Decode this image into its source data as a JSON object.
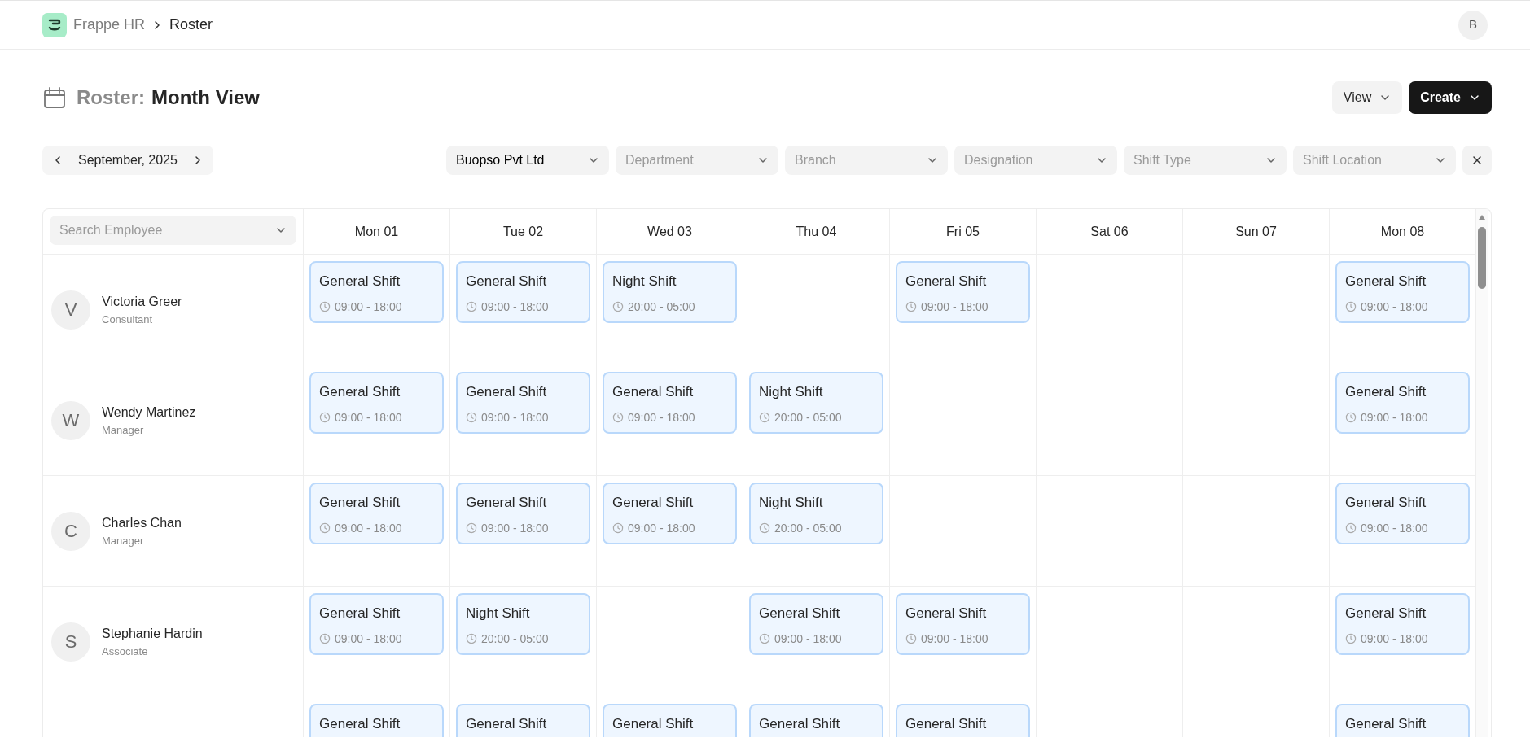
{
  "breadcrumbs": [
    {
      "label": "Frappe HR",
      "current": false
    },
    {
      "label": "Roster",
      "current": true
    }
  ],
  "user_avatar": {
    "initial": "B"
  },
  "page_header": {
    "title_prefix": "Roster:",
    "title": "Month View",
    "buttons": [
      {
        "label": "View",
        "kind": "secondary"
      },
      {
        "label": "Create",
        "kind": "primary"
      }
    ]
  },
  "month_nav": {
    "label": "September, 2025"
  },
  "filters": [
    {
      "value": "Buopso Pvt Ltd"
    },
    {
      "placeholder": "Department"
    },
    {
      "placeholder": "Branch"
    },
    {
      "placeholder": "Designation"
    },
    {
      "placeholder": "Shift Type"
    },
    {
      "placeholder": "Shift Location"
    }
  ],
  "roster": {
    "search": {
      "placeholder": "Search Employee"
    },
    "days": [
      "Mon 01",
      "Tue 02",
      "Wed 03",
      "Thu 04",
      "Fri 05",
      "Sat 06",
      "Sun 07",
      "Mon 08"
    ],
    "employees": [
      {
        "initial": "V",
        "name": "Victoria Greer",
        "designation": "Consultant",
        "cells": [
          {
            "kind": "shift",
            "title": "General Shift",
            "time": "09:00 - 18:00"
          },
          {
            "kind": "shift",
            "title": "General Shift",
            "time": "09:00 - 18:00"
          },
          {
            "kind": "shift",
            "title": "Night Shift",
            "time": "20:00 - 05:00"
          },
          {
            "kind": "empty"
          },
          {
            "kind": "shift",
            "title": "General Shift",
            "time": "09:00 - 18:00"
          },
          {
            "kind": "empty"
          },
          {
            "kind": "empty"
          },
          {
            "kind": "shift",
            "title": "General Shift",
            "time": "09:00 - 18:00"
          }
        ]
      },
      {
        "initial": "W",
        "name": "Wendy Martinez",
        "designation": "Manager",
        "cells": [
          {
            "kind": "shift",
            "title": "General Shift",
            "time": "09:00 - 18:00"
          },
          {
            "kind": "shift",
            "title": "General Shift",
            "time": "09:00 - 18:00"
          },
          {
            "kind": "shift",
            "title": "General Shift",
            "time": "09:00 - 18:00"
          },
          {
            "kind": "shift",
            "title": "Night Shift",
            "time": "20:00 - 05:00"
          },
          {
            "kind": "empty"
          },
          {
            "kind": "empty"
          },
          {
            "kind": "empty"
          },
          {
            "kind": "shift",
            "title": "General Shift",
            "time": "09:00 - 18:00"
          }
        ]
      },
      {
        "initial": "C",
        "name": "Charles Chan",
        "designation": "Manager",
        "cells": [
          {
            "kind": "shift",
            "title": "General Shift",
            "time": "09:00 - 18:00"
          },
          {
            "kind": "shift",
            "title": "General Shift",
            "time": "09:00 - 18:00"
          },
          {
            "kind": "shift",
            "title": "General Shift",
            "time": "09:00 - 18:00"
          },
          {
            "kind": "shift",
            "title": "Night Shift",
            "time": "20:00 - 05:00"
          },
          {
            "kind": "empty"
          },
          {
            "kind": "empty"
          },
          {
            "kind": "empty"
          },
          {
            "kind": "shift",
            "title": "General Shift",
            "time": "09:00 - 18:00"
          }
        ]
      },
      {
        "initial": "S",
        "name": "Stephanie Hardin",
        "designation": "Associate",
        "cells": [
          {
            "kind": "shift",
            "title": "General Shift",
            "time": "09:00 - 18:00"
          },
          {
            "kind": "shift",
            "title": "Night Shift",
            "time": "20:00 - 05:00"
          },
          {
            "kind": "empty"
          },
          {
            "kind": "shift",
            "title": "General Shift",
            "time": "09:00 - 18:00"
          },
          {
            "kind": "shift",
            "title": "General Shift",
            "time": "09:00 - 18:00"
          },
          {
            "kind": "empty"
          },
          {
            "kind": "empty"
          },
          {
            "kind": "shift",
            "title": "General Shift",
            "time": "09:00 - 18:00"
          }
        ]
      },
      {
        "cells": [
          {
            "kind": "shift",
            "title": "General Shift"
          },
          {
            "kind": "shift",
            "title": "General Shift"
          },
          {
            "kind": "shift",
            "title": "General Shift"
          },
          {
            "kind": "shift",
            "title": "General Shift"
          },
          {
            "kind": "shift",
            "title": "General Shift"
          },
          {
            "kind": "empty"
          },
          {
            "kind": "empty"
          },
          {
            "kind": "shift",
            "title": "General Shift"
          }
        ]
      }
    ]
  }
}
